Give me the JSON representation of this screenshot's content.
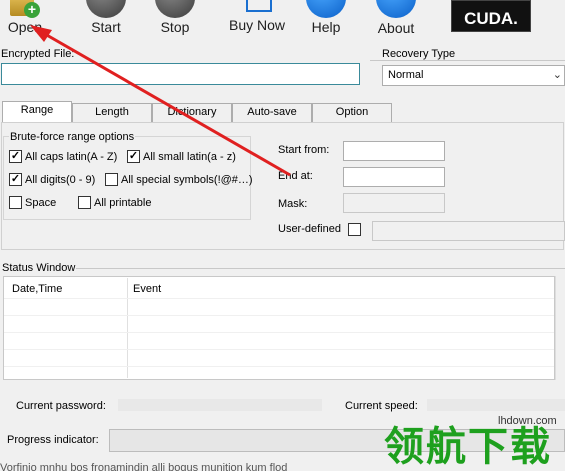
{
  "toolbar": {
    "open": "Open",
    "start": "Start",
    "stop": "Stop",
    "buy_now": "Buy Now",
    "help": "Help",
    "about": "About",
    "cuda": "CUDA."
  },
  "encrypted_file": {
    "label": "Encrypted File:",
    "value": ""
  },
  "recovery_type": {
    "label": "Recovery Type",
    "selected": "Normal"
  },
  "tabs": [
    {
      "label": "Range",
      "active": true
    },
    {
      "label": "Length",
      "active": false
    },
    {
      "label": "Dictionary",
      "active": false
    },
    {
      "label": "Auto-save",
      "active": false
    },
    {
      "label": "Option",
      "active": false
    }
  ],
  "range": {
    "group_title": "Brute-force range options",
    "options": [
      {
        "label": "All caps latin(A - Z)",
        "checked": true
      },
      {
        "label": "All small latin(a - z)",
        "checked": true
      },
      {
        "label": "All digits(0 - 9)",
        "checked": true
      },
      {
        "label": "All special symbols(!@#…)",
        "checked": false
      },
      {
        "label": "Space",
        "checked": false
      },
      {
        "label": "All printable",
        "checked": false
      }
    ],
    "start_from_label": "Start from:",
    "end_at_label": "End at:",
    "mask_label": "Mask:",
    "user_defined_label": "User-defined"
  },
  "status": {
    "title": "Status Window",
    "columns": [
      "Date,Time",
      "Event"
    ]
  },
  "footer": {
    "current_password_label": "Current password:",
    "current_speed_label": "Current speed:",
    "progress_label": "Progress indicator:"
  },
  "watermark": {
    "text": "领航下载",
    "url": "lhdown.com"
  },
  "bottom_text": "Vorfinio mnhu bos fronamindin alli bogus munition kum flod"
}
